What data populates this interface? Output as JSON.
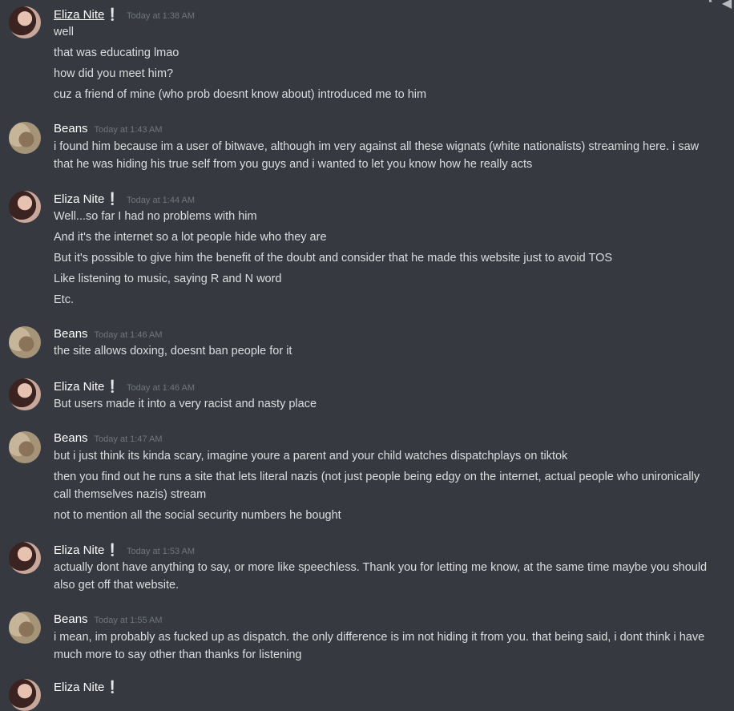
{
  "messages": [
    {
      "author": "Eliza Nite",
      "badge": "❕",
      "time": "Today at 1:38 AM",
      "lines": [
        "well",
        "that was educating lmao",
        "how did you meet him?",
        "cuz a friend of mine (who prob doesnt know about) introduced me to him"
      ]
    },
    {
      "author": "Beans",
      "time": "Today at 1:43 AM",
      "lines": [
        "i found him because im a user of bitwave, although im very against all these wignats (white nationalists) streaming here. i saw",
        "that he was hiding his true self from you guys and i wanted to let you know how he really acts"
      ]
    },
    {
      "author": "Eliza Nite",
      "badge": "❕",
      "time": "Today at 1:44 AM",
      "lines": [
        "Well...so far I had no problems with him",
        "And it's the internet so a lot people hide who they are",
        "But it's possible to give him the benefit of the doubt and consider that he made this website just to avoid TOS",
        "Like listening to music, saying R and N word",
        "Etc."
      ]
    },
    {
      "author": "Beans",
      "time": "Today at 1:46 AM",
      "lines": [
        "the site allows doxing, doesnt ban people for it"
      ]
    },
    {
      "author": "Eliza Nite",
      "badge": "❕",
      "time": "Today at 1:46 AM",
      "lines": [
        "But users made it into a very racist and nasty place"
      ]
    },
    {
      "author": "Beans",
      "time": "Today at 1:47 AM",
      "lines": [
        "but i just think its kinda scary, imagine youre a parent and your child watches dispatchplays on tiktok",
        "then you find out he runs a site that lets literal nazis (not just people being edgy on the internet, actual people who unironically",
        "call themselves nazis) stream",
        "not to mention all the social security numbers he bought"
      ]
    },
    {
      "author": "Eliza Nite",
      "badge": "❕",
      "time": "Today at 1:53 AM",
      "lines": [
        "actually dont have anything to say, or more like  speechless. Thank you for letting me know, at the same time maybe you should",
        "also get off that website."
      ]
    },
    {
      "author": "Beans",
      "time": "Today at 1:55 AM",
      "lines": [
        "i mean, im probably as fucked up as dispatch. the only difference is im not hiding it from you. that being said, i dont think i have",
        "much more to say other than thanks for listening"
      ]
    },
    {
      "author": "Eliza Nite",
      "badge": "❕",
      "time": "",
      "lines": []
    }
  ],
  "icons": {
    "reaction": "add-reaction-icon",
    "reply": "reply-icon"
  }
}
